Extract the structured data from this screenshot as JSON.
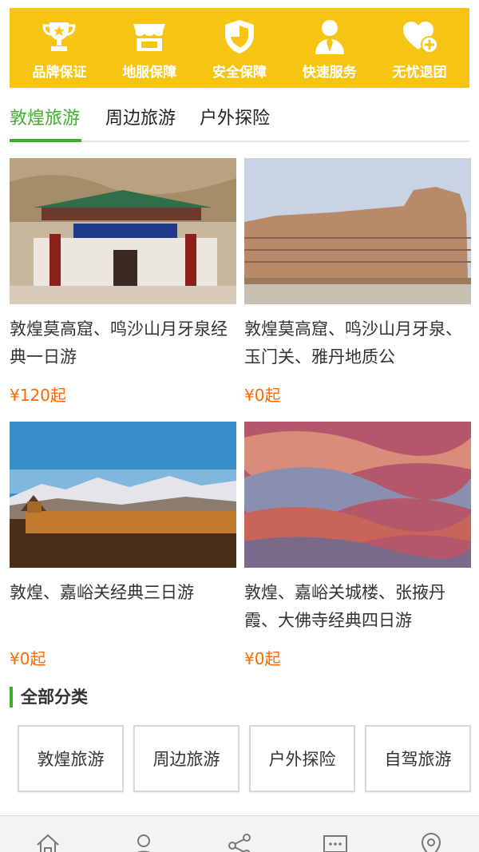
{
  "guarantees": [
    {
      "label": "品牌保证",
      "icon": "trophy-icon"
    },
    {
      "label": "地服保障",
      "icon": "shop-icon"
    },
    {
      "label": "安全保障",
      "icon": "shield-icon"
    },
    {
      "label": "快速服务",
      "icon": "person-icon"
    },
    {
      "label": "无忧退团",
      "icon": "heart-plus-icon"
    }
  ],
  "tabs": [
    {
      "label": "敦煌旅游",
      "active": true
    },
    {
      "label": "周边旅游",
      "active": false
    },
    {
      "label": "户外探险",
      "active": false
    }
  ],
  "products": [
    {
      "title": "敦煌莫高窟、鸣沙山月牙泉经典一日游",
      "price": "¥120起"
    },
    {
      "title": "敦煌莫高窟、鸣沙山月牙泉、玉门关、雅丹地质公",
      "price": "¥0起"
    },
    {
      "title": "敦煌、嘉峪关经典三日游",
      "price": "¥0起"
    },
    {
      "title": "敦煌、嘉峪关城楼、张掖丹霞、大佛寺经典四日游",
      "price": "¥0起"
    }
  ],
  "categories_section": {
    "title": "全部分类",
    "items": [
      "敦煌旅游",
      "周边旅游",
      "户外探险",
      "自驾旅游"
    ]
  },
  "bottom_nav": [
    {
      "icon": "home-icon"
    },
    {
      "icon": "user-icon"
    },
    {
      "icon": "share-icon"
    },
    {
      "icon": "message-icon"
    },
    {
      "icon": "location-icon"
    }
  ],
  "colors": {
    "accent": "#3cae2a",
    "banner": "#f6c514",
    "price": "#ff6a00"
  }
}
